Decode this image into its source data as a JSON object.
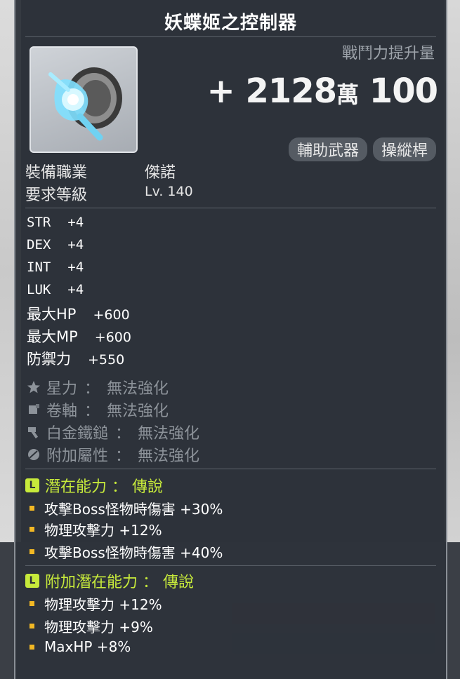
{
  "item": {
    "name": "妖蝶姬之控制器",
    "cp_label": "戰鬥力提升量",
    "cp_main": "+ 2128",
    "cp_unit": "萬",
    "cp_rest": "100",
    "tags": [
      "輔助武器",
      "操縱桿"
    ]
  },
  "requirements": {
    "job_label": "裝備職業",
    "job_value": "傑諾",
    "level_label": "要求等級",
    "level_value": "Lv. 140"
  },
  "stats": [
    {
      "name": "STR",
      "value": "+4"
    },
    {
      "name": "DEX",
      "value": "+4"
    },
    {
      "name": "INT",
      "value": "+4"
    },
    {
      "name": "LUK",
      "value": "+4"
    },
    {
      "name": "最大HP",
      "value": "+600"
    },
    {
      "name": "最大MP",
      "value": "+600"
    },
    {
      "name": "防禦力",
      "value": "+550"
    }
  ],
  "enhancements": [
    {
      "label": "星力",
      "value": "無法強化",
      "icon": "star-icon"
    },
    {
      "label": "卷軸",
      "value": "無法強化",
      "icon": "scroll-icon"
    },
    {
      "label": "白金鐵鎚",
      "value": "無法強化",
      "icon": "hammer-icon"
    },
    {
      "label": "附加屬性",
      "value": "無法強化",
      "icon": "leaf-icon"
    }
  ],
  "potential": {
    "title": "潛在能力 ： 傳說",
    "badge": "L",
    "lines": [
      "攻擊Boss怪物時傷害 +30%",
      "物理攻擊力 +12%",
      "攻擊Boss怪物時傷害 +40%"
    ]
  },
  "bonus_potential": {
    "title": "附加潛在能力 ： 傳說",
    "badge": "L",
    "lines": [
      "物理攻擊力 +12%",
      "物理攻擊力 +9%",
      "MaxHP +8%"
    ]
  },
  "colors": {
    "accent": "#c7ea3b",
    "bullet": "#f2b824",
    "panel": "#2e333a"
  }
}
